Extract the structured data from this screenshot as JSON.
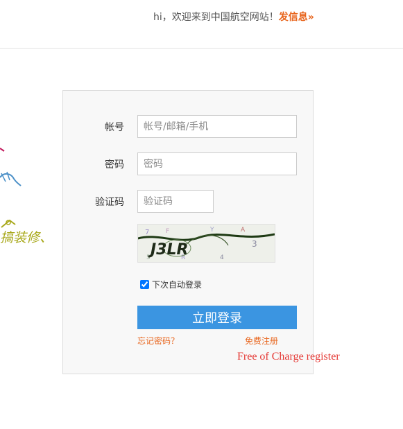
{
  "header": {
    "greeting": "hi，欢迎来到中国航空网站！",
    "post_link": "发信息»"
  },
  "decoration": {
    "text": "搞装修、"
  },
  "login": {
    "account": {
      "label": "帐号",
      "placeholder": "帐号/邮箱/手机",
      "value": ""
    },
    "password": {
      "label": "密码",
      "placeholder": "密码",
      "value": ""
    },
    "captcha": {
      "label": "验证码",
      "placeholder": "验证码",
      "value": "",
      "image_text": "J3LR"
    },
    "remember": {
      "label": "下次自动登录",
      "checked": true
    },
    "submit_label": "立即登录",
    "forgot_label": "忘记密码？",
    "register_label": "免费注册"
  },
  "annotation": "Free of Charge register",
  "colors": {
    "accent_orange": "#e8641b",
    "button_blue": "#3b95e1",
    "annotation_red": "#e53935",
    "panel_bg": "#f8f8f8"
  }
}
